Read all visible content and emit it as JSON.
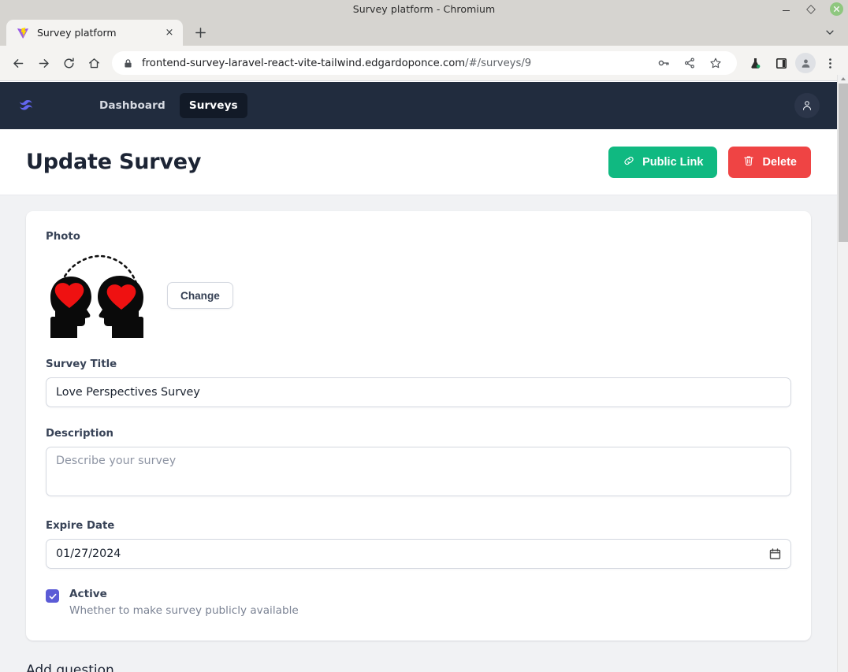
{
  "window": {
    "title": "Survey platform - Chromium",
    "controls": {
      "minimize": "minimize-button",
      "maximize": "maximize-button",
      "close": "close-button"
    }
  },
  "browser": {
    "tab": {
      "title": "Survey platform",
      "favicon": "vite-logo-icon",
      "close_label": "×"
    },
    "new_tab_label": "+",
    "toolbar": {
      "back": "back-arrow-icon",
      "forward": "forward-arrow-icon",
      "reload": "reload-icon",
      "home": "home-icon",
      "lock": "lock-icon",
      "url_domain": "frontend-survey-laravel-react-vite-tailwind.edgardoponce.com",
      "url_path": "/#/surveys/9",
      "actions": [
        "key-icon",
        "share-icon",
        "bookmark-star-icon"
      ],
      "extensions": [
        "flask-experiments-icon",
        "side-panel-icon"
      ],
      "profile": "profile-avatar-icon",
      "menu": "three-dot-menu-icon"
    }
  },
  "app": {
    "navbar": {
      "brand": "tailwind-logo-icon",
      "links": [
        {
          "label": "Dashboard",
          "active": false
        },
        {
          "label": "Surveys",
          "active": true
        }
      ],
      "user_icon": "user-avatar-icon"
    },
    "header": {
      "title": "Update Survey",
      "buttons": [
        {
          "label": "Public Link",
          "icon": "link-chain-icon",
          "color": "#10b981"
        },
        {
          "label": "Delete",
          "icon": "trash-icon",
          "color": "#ef4444"
        }
      ]
    },
    "form": {
      "photo": {
        "label": "Photo",
        "image_alt": "two-heads-with-hearts-illustration",
        "change_button": "Change"
      },
      "title_field": {
        "label": "Survey Title",
        "value": "Love Perspectives Survey",
        "placeholder": ""
      },
      "description_field": {
        "label": "Description",
        "value": "",
        "placeholder": "Describe your survey"
      },
      "expire_field": {
        "label": "Expire Date",
        "value": "01/27/2024",
        "icon": "calendar-icon"
      },
      "active_checkbox": {
        "checked": true,
        "label": "Active",
        "description": "Whether to make survey publicly available",
        "accent": "#5b5bd6"
      },
      "add_question": "Add question"
    }
  },
  "colors": {
    "navbar_bg": "#212c3e",
    "nav_active_bg": "#121a27",
    "page_bg": "#f1f2f4",
    "green": "#10b981",
    "red": "#ef4444",
    "indigo": "#5b5bd6"
  }
}
